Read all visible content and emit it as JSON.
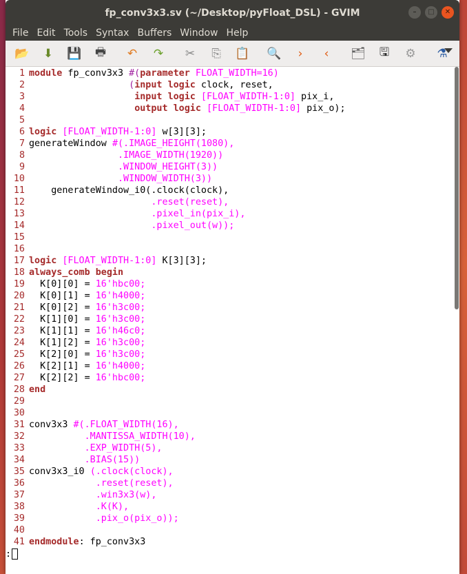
{
  "window": {
    "title": "fp_conv3x3.sv (~/Desktop/pyFloat_DSL) - GVIM",
    "buttons": {
      "minimize": "–",
      "maximize": "□",
      "close": "✕"
    }
  },
  "menu": [
    "File",
    "Edit",
    "Tools",
    "Syntax",
    "Buffers",
    "Window",
    "Help"
  ],
  "toolbar": [
    {
      "name": "open-icon",
      "glyph": "📂"
    },
    {
      "name": "save-download-icon",
      "glyph": "⬇"
    },
    {
      "name": "save-icon",
      "glyph": "💾"
    },
    {
      "name": "print-icon",
      "glyph": "🖶"
    },
    {
      "name": "undo-icon",
      "glyph": "↶"
    },
    {
      "name": "redo-icon",
      "glyph": "↷"
    },
    {
      "name": "cut-icon",
      "glyph": "✂"
    },
    {
      "name": "copy-icon",
      "glyph": "⎘"
    },
    {
      "name": "paste-icon",
      "glyph": "📋"
    },
    {
      "name": "find-replace-icon",
      "glyph": "🔍"
    },
    {
      "name": "find-next-icon",
      "glyph": "›"
    },
    {
      "name": "find-previous-icon",
      "glyph": "‹"
    },
    {
      "name": "load-session-icon",
      "glyph": "🗂"
    },
    {
      "name": "save-session-icon",
      "glyph": "🖫"
    },
    {
      "name": "run-script-icon",
      "glyph": "⚙"
    },
    {
      "name": "make-icon",
      "glyph": "⚗"
    }
  ],
  "code": [
    [
      {
        "t": "module",
        "c": "kw"
      },
      {
        "t": " fp_conv3x3 ",
        "c": "tx"
      },
      {
        "t": "#(",
        "c": "st"
      },
      {
        "t": "parameter",
        "c": "kw"
      },
      {
        "t": " FLOAT_WIDTH=16)",
        "c": "mg"
      }
    ],
    [
      {
        "t": "                  (",
        "c": "st"
      },
      {
        "t": "input",
        "c": "kw"
      },
      {
        "t": " ",
        "c": "tx"
      },
      {
        "t": "logic",
        "c": "kw"
      },
      {
        "t": " clock, reset,",
        "c": "tx"
      }
    ],
    [
      {
        "t": "                   ",
        "c": "tx"
      },
      {
        "t": "input",
        "c": "kw"
      },
      {
        "t": " ",
        "c": "tx"
      },
      {
        "t": "logic",
        "c": "kw"
      },
      {
        "t": " [FLOAT_WIDTH-1:0]",
        "c": "mg"
      },
      {
        "t": " pix_i,",
        "c": "tx"
      }
    ],
    [
      {
        "t": "                   ",
        "c": "tx"
      },
      {
        "t": "output",
        "c": "kw"
      },
      {
        "t": " ",
        "c": "tx"
      },
      {
        "t": "logic",
        "c": "kw"
      },
      {
        "t": " [FLOAT_WIDTH-1:0]",
        "c": "mg"
      },
      {
        "t": " pix_o);",
        "c": "tx"
      }
    ],
    [],
    [
      {
        "t": "logic",
        "c": "kw"
      },
      {
        "t": " [FLOAT_WIDTH-1:0]",
        "c": "mg"
      },
      {
        "t": " w[3][3];",
        "c": "tx"
      }
    ],
    [
      {
        "t": "generateWindow ",
        "c": "tx"
      },
      {
        "t": "#(.IMAGE_HEIGHT(1080),",
        "c": "mg"
      }
    ],
    [
      {
        "t": "                ",
        "c": "tx"
      },
      {
        "t": ".IMAGE_WIDTH(1920)",
        "c": "mg"
      },
      {
        "t": ")",
        "c": "mg"
      }
    ],
    [
      {
        "t": "                ",
        "c": "tx"
      },
      {
        "t": ".WINDOW_HEIGHT(3))",
        "c": "mg"
      }
    ],
    [
      {
        "t": "                ",
        "c": "tx"
      },
      {
        "t": ".WINDOW_WIDTH(3))",
        "c": "mg"
      }
    ],
    [
      {
        "t": "    generateWindow_i0(.clock(clock),",
        "c": "tx"
      }
    ],
    [
      {
        "t": "                      ",
        "c": "tx"
      },
      {
        "t": ".reset(reset),",
        "c": "mg"
      }
    ],
    [
      {
        "t": "                      ",
        "c": "tx"
      },
      {
        "t": ".pixel_in(pix_i),",
        "c": "mg"
      }
    ],
    [
      {
        "t": "                      ",
        "c": "tx"
      },
      {
        "t": ".pixel_out(w));",
        "c": "mg"
      }
    ],
    [],
    [],
    [
      {
        "t": "logic",
        "c": "kw"
      },
      {
        "t": " [FLOAT_WIDTH-1:0]",
        "c": "mg"
      },
      {
        "t": " K[3][3];",
        "c": "tx"
      }
    ],
    [
      {
        "t": "always_comb begin",
        "c": "kw"
      }
    ],
    [
      {
        "t": "  K[0][0] = ",
        "c": "tx"
      },
      {
        "t": "16'hbc00;",
        "c": "mg"
      }
    ],
    [
      {
        "t": "  K[0][1] = ",
        "c": "tx"
      },
      {
        "t": "16'h4000;",
        "c": "mg"
      }
    ],
    [
      {
        "t": "  K[0][2] = ",
        "c": "tx"
      },
      {
        "t": "16'h3c00;",
        "c": "mg"
      }
    ],
    [
      {
        "t": "  K[1][0] = ",
        "c": "tx"
      },
      {
        "t": "16'h3c00;",
        "c": "mg"
      }
    ],
    [
      {
        "t": "  K[1][1] = ",
        "c": "tx"
      },
      {
        "t": "16'h46c0;",
        "c": "mg"
      }
    ],
    [
      {
        "t": "  K[1][2] = ",
        "c": "tx"
      },
      {
        "t": "16'h3c00;",
        "c": "mg"
      }
    ],
    [
      {
        "t": "  K[2][0] = ",
        "c": "tx"
      },
      {
        "t": "16'h3c00;",
        "c": "mg"
      }
    ],
    [
      {
        "t": "  K[2][1] = ",
        "c": "tx"
      },
      {
        "t": "16'h4000;",
        "c": "mg"
      }
    ],
    [
      {
        "t": "  K[2][2] = ",
        "c": "tx"
      },
      {
        "t": "16'hbc00;",
        "c": "mg"
      }
    ],
    [
      {
        "t": "end",
        "c": "kw"
      }
    ],
    [],
    [],
    [
      {
        "t": "conv3x3 ",
        "c": "tx"
      },
      {
        "t": "#(.FLOAT_WIDTH(16),",
        "c": "mg"
      }
    ],
    [
      {
        "t": "          ",
        "c": "tx"
      },
      {
        "t": ".MANTISSA_WIDTH(10),",
        "c": "mg"
      }
    ],
    [
      {
        "t": "          ",
        "c": "tx"
      },
      {
        "t": ".EXP_WIDTH(5),",
        "c": "mg"
      }
    ],
    [
      {
        "t": "          ",
        "c": "tx"
      },
      {
        "t": ".BIAS(15))",
        "c": "mg"
      }
    ],
    [
      {
        "t": "conv3x3_i0 ",
        "c": "tx"
      },
      {
        "t": "(.clock(clock),",
        "c": "mg"
      }
    ],
    [
      {
        "t": "            ",
        "c": "tx"
      },
      {
        "t": ".reset(reset),",
        "c": "mg"
      }
    ],
    [
      {
        "t": "            ",
        "c": "tx"
      },
      {
        "t": ".win3x3(w),",
        "c": "mg"
      }
    ],
    [
      {
        "t": "            ",
        "c": "tx"
      },
      {
        "t": ".K(K),",
        "c": "mg"
      }
    ],
    [
      {
        "t": "            ",
        "c": "tx"
      },
      {
        "t": ".pix_o(pix_o));",
        "c": "mg"
      }
    ],
    [],
    [
      {
        "t": "endmodule",
        "c": "kw"
      },
      {
        "t": ": fp_conv3x3",
        "c": "tx"
      }
    ]
  ],
  "cmdline": {
    "text": ":"
  }
}
